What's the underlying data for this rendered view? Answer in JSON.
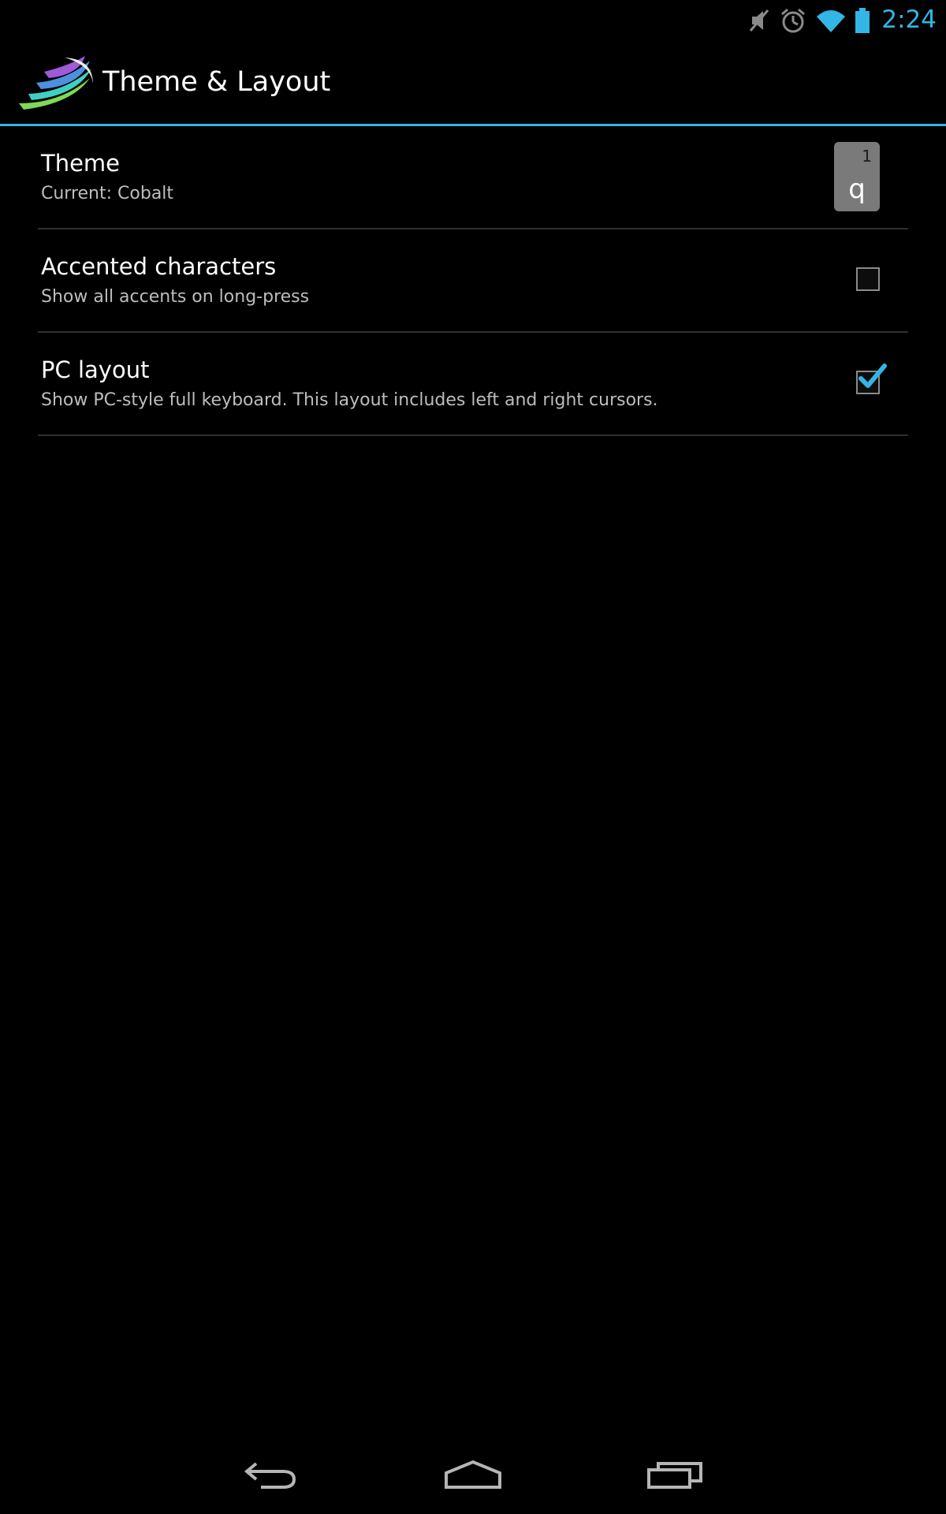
{
  "status_bar": {
    "time": "2:24",
    "icons": [
      "mute-icon",
      "alarm-icon",
      "wifi-icon",
      "battery-icon"
    ],
    "accent_color": "#33b5e5"
  },
  "action_bar": {
    "title": "Theme & Layout",
    "logo_icon": "swiftkey-logo-icon",
    "divider_color": "#33b5e5"
  },
  "preferences": [
    {
      "title": "Theme",
      "summary": "Current: Cobalt",
      "widget": "theme-preview",
      "preview_number": "1",
      "preview_letter": "q"
    },
    {
      "title": "Accented characters",
      "summary": "Show all accents on long-press",
      "widget": "checkbox",
      "checked": false
    },
    {
      "title": "PC layout",
      "summary": "Show PC-style full keyboard. This layout includes left and right cursors.",
      "widget": "checkbox",
      "checked": true
    }
  ],
  "nav_bar": {
    "buttons": [
      "back-icon",
      "home-icon",
      "recent-apps-icon"
    ]
  }
}
